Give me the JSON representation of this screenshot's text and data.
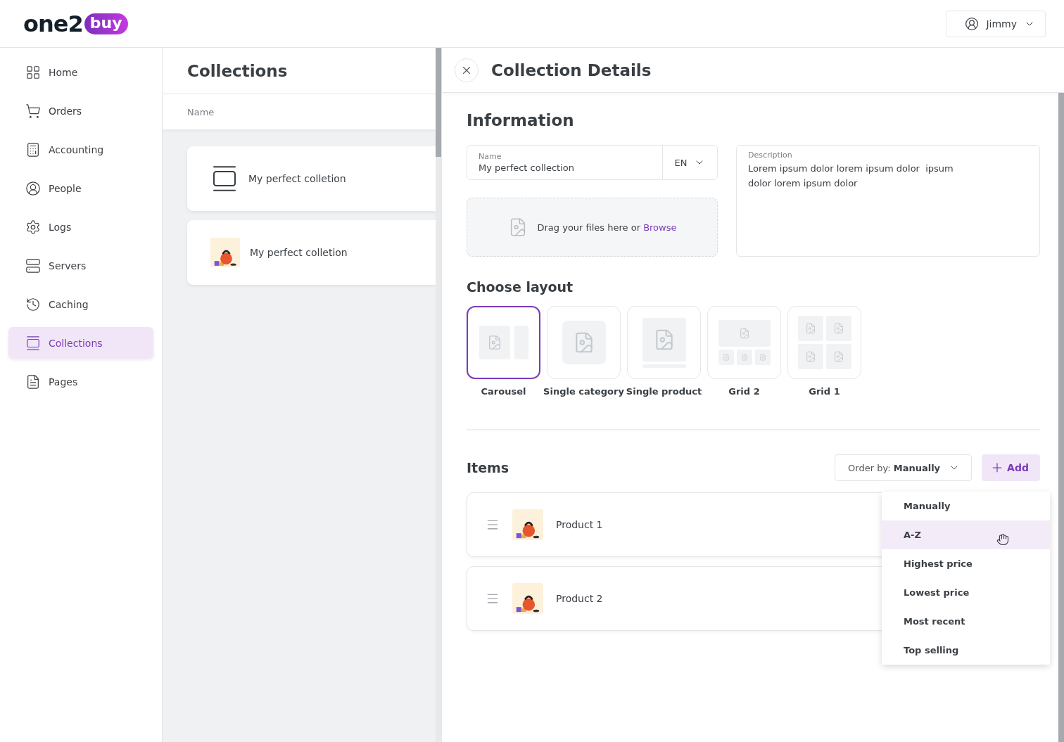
{
  "logo": {
    "text": "one2",
    "badge": "buy"
  },
  "user": {
    "name": "Jimmy"
  },
  "sidebar": {
    "items": [
      {
        "label": "Home",
        "selected": false
      },
      {
        "label": "Orders",
        "selected": false
      },
      {
        "label": "Accounting",
        "selected": false
      },
      {
        "label": "People",
        "selected": false
      },
      {
        "label": "Logs",
        "selected": false
      },
      {
        "label": "Servers",
        "selected": false
      },
      {
        "label": "Caching",
        "selected": false
      },
      {
        "label": "Collections",
        "selected": true
      },
      {
        "label": "Pages",
        "selected": false
      }
    ]
  },
  "collections": {
    "title": "Collections",
    "column": "Name",
    "items": [
      {
        "name": "My perfect colletion",
        "kind": "layout"
      },
      {
        "name": "My perfect colletion",
        "kind": "photo"
      }
    ]
  },
  "details": {
    "title": "Collection Details",
    "section": "Information",
    "name_field": {
      "label": "Name",
      "value": "My perfect collection",
      "language": "EN"
    },
    "description": {
      "label": "Description",
      "value": "Lorem ipsum dolor lorem ipsum dolor  ipsum dolor lorem ipsum dolor"
    },
    "upload": {
      "text": "Drag your files here or",
      "link": "Browse"
    },
    "layout_title": "Choose layout",
    "layouts": [
      {
        "label": "Carousel",
        "kind": "carousel",
        "selected": true
      },
      {
        "label": "Single category",
        "kind": "single",
        "selected": false
      },
      {
        "label": "Single product",
        "kind": "product",
        "selected": false
      },
      {
        "label": "Grid 2",
        "kind": "grid2",
        "selected": false
      },
      {
        "label": "Grid 1",
        "kind": "grid1",
        "selected": false
      }
    ],
    "items_title": "Items",
    "order": {
      "prefix": "Order by:",
      "value": "Manually"
    },
    "add_button": "Add",
    "items": [
      {
        "name": "Product 1"
      },
      {
        "name": "Product 2"
      }
    ],
    "order_menu": [
      {
        "label": "Manually",
        "highlighted": false
      },
      {
        "label": "A-Z",
        "highlighted": true
      },
      {
        "label": "Highest price",
        "highlighted": false
      },
      {
        "label": "Lowest price",
        "highlighted": false
      },
      {
        "label": "Most recent",
        "highlighted": false
      },
      {
        "label": "Top selling",
        "highlighted": false
      }
    ]
  }
}
